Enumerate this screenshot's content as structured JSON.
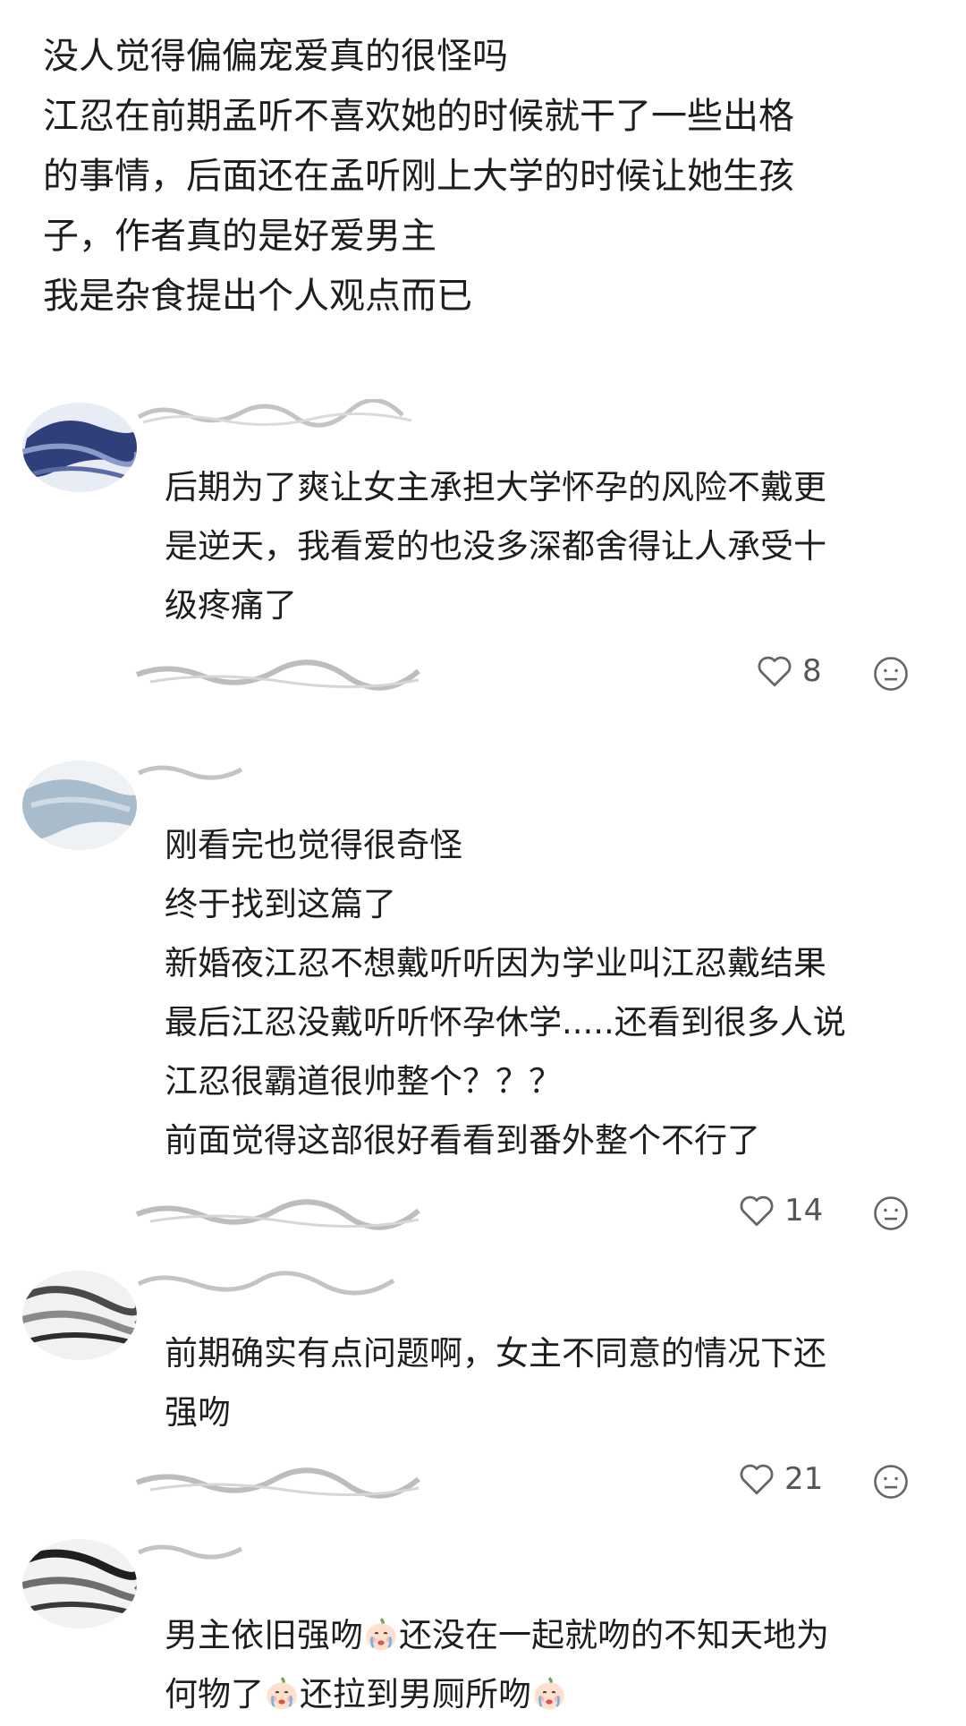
{
  "post": {
    "lines": [
      "没人觉得偏偏宠爱真的很怪吗",
      "江忍在前期孟听不喜欢她的时候就干了一些出格",
      "的事情，后面还在孟听刚上大学的时候让她生孩",
      "子，作者真的是好爱男主",
      "我是杂食提出个人观点而已"
    ]
  },
  "comments": [
    {
      "lines": [
        "后期为了爽让女主承担大学怀孕的风险不戴更",
        "是逆天，我看爱的也没多深都舍得让人承受十",
        "级疼痛了"
      ],
      "likes": "8"
    },
    {
      "lines": [
        "刚看完也觉得很奇怪",
        "终于找到这篇了",
        "新婚夜江忍不想戴听听因为学业叫江忍戴结果",
        "最后江忍没戴听听怀孕休学.....还看到很多人说",
        "江忍很霸道很帅整个？？？",
        "前面觉得这部很好看看到番外整个不行了"
      ],
      "likes": "14"
    },
    {
      "lines": [
        "前期确实有点问题啊，女主不同意的情况下还",
        "强吻"
      ],
      "likes": "21"
    },
    {
      "line1_a": "男主依旧强吻",
      "line1_b": "还没在一起就吻的不知天地为",
      "line2_a": "何物了",
      "line2_b": "还拉到男厕所吻",
      "emoji": "crying-face-emoji"
    }
  ],
  "icons": {
    "like": "heart-outline-icon",
    "reaction": "neutral-face-icon"
  },
  "colors": {
    "text": "#1e1e1e",
    "meta": "#555555",
    "background": "#ffffff"
  }
}
